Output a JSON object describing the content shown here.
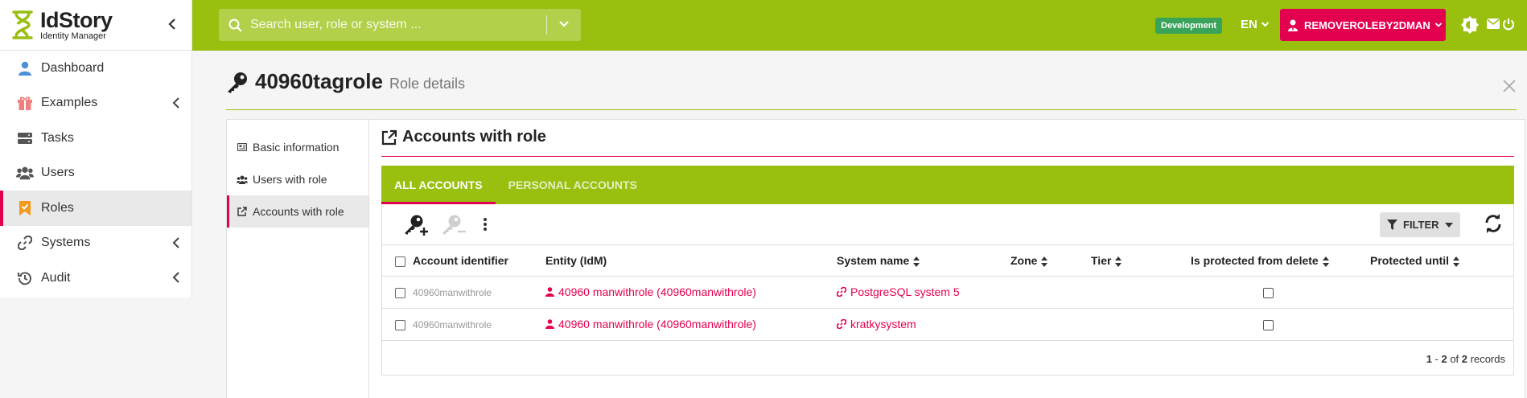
{
  "brand": {
    "title": "IdStory",
    "subtitle": "Identity Manager",
    "accent": "#99bf0f",
    "primary": "#e40050"
  },
  "sidebar": {
    "items": [
      {
        "label": "Dashboard",
        "icon": "user-icon"
      },
      {
        "label": "Examples",
        "icon": "gift-icon"
      },
      {
        "label": "Tasks",
        "icon": "server-icon"
      },
      {
        "label": "Users",
        "icon": "users-icon"
      },
      {
        "label": "Roles",
        "icon": "bookmark-icon"
      },
      {
        "label": "Systems",
        "icon": "link-icon"
      },
      {
        "label": "Audit",
        "icon": "history-icon"
      }
    ]
  },
  "topbar": {
    "search_placeholder": "Search user, role or system ...",
    "environment": "Development",
    "language": "EN",
    "user": "REMOVEROLEBY2DMAN"
  },
  "page": {
    "title": "40960tagrole",
    "subtitle": "Role details"
  },
  "subnav": {
    "items": [
      {
        "label": "Basic information"
      },
      {
        "label": "Users with role"
      },
      {
        "label": "Accounts with role"
      }
    ]
  },
  "section": {
    "title": "Accounts with role"
  },
  "tabs": [
    {
      "label": "All accounts"
    },
    {
      "label": "Personal accounts"
    }
  ],
  "toolbar": {
    "filter_label": "FILTER"
  },
  "table": {
    "columns": [
      "Account identifier",
      "Entity (IdM)",
      "System name",
      "Zone",
      "Tier",
      "Is protected from delete",
      "Protected until"
    ],
    "rows": [
      {
        "account": "40960manwithrole",
        "entity": "40960 manwithrole (40960manwithrole)",
        "system": "PostgreSQL system 5",
        "zone": "",
        "tier": "",
        "protected_until": ""
      },
      {
        "account": "40960manwithrole",
        "entity": "40960 manwithrole (40960manwithrole)",
        "system": "kratkysystem",
        "zone": "",
        "tier": "",
        "protected_until": ""
      }
    ]
  },
  "pagination": {
    "from": "1",
    "sep": " - ",
    "to": "2",
    "of": " of ",
    "total": "2",
    "suffix": " records"
  }
}
